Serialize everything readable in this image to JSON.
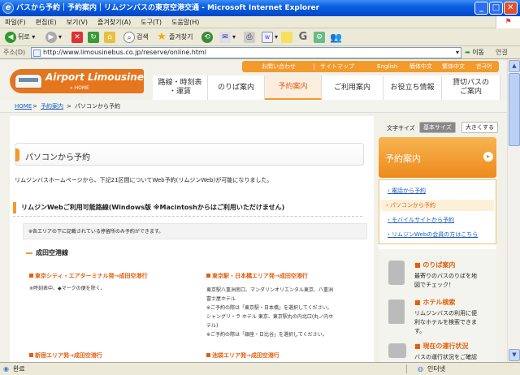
{
  "window": {
    "title": "バスから予約｜予約案内｜リムジンバスの東京空港交通 - Microsoft Internet Explorer"
  },
  "menu": [
    "파일(F)",
    "편집(E)",
    "보기(V)",
    "즐겨찾기(A)",
    "도구(T)",
    "도움말(H)"
  ],
  "toolbar": {
    "back": "뒤로",
    "search": "검색",
    "favorites": "즐겨찾기"
  },
  "address": {
    "label": "주소(D)",
    "url": "http://www.limousinebus.co.jp/reserve/online.html",
    "go": "이동",
    "links": "연결"
  },
  "status": {
    "left": "완료",
    "zone": "인터넷"
  },
  "site": {
    "topnav": [
      "お問い合わせ",
      "サイトマップ",
      "English",
      "簡体中文",
      "繁体中文",
      "한국어"
    ],
    "logo": {
      "name": "Airport Limousine",
      "home": "» HOME"
    },
    "nav": [
      "路線・時刻表\n・運賃",
      "のりば案内",
      "予約案内",
      "ご利用案内",
      "お役立ち情報",
      "貸切バスの\nご案内"
    ],
    "breadcrumb": {
      "home": "HOME",
      "sep": ">",
      "reserve": "予約案内",
      "current": "パソコンから予約"
    },
    "fontsize": {
      "label": "文字サイズ",
      "normal": "基本サイズ",
      "large": "大きくする"
    },
    "heading": "パソコンから予約",
    "intro": "リムジンバスホームページから、下記21区間についてWeb予約(リムジンWeb)が可能になりました。",
    "routes_title": "リムジンWebご利用可能路線(Windows版 ※Macintoshからはご利用いただけません)",
    "note": "※各エリアの下に記載されている停留所のみ予約ができます。",
    "narita": "成田空港線",
    "route1": {
      "title": "東京シティ・エアターミナル発→成田空港行",
      "desc": "※時刻表中、◆マークの便を除く。"
    },
    "route2": {
      "title": "東京駅・日本橋エリア発→成田空港行",
      "lines": [
        "東京駅八重洲南口、マンダリンオリエンタル東京、八重洲",
        "富士屋ホテル",
        "※ご予約の際は「東京駅・日本橋」を選択してください。",
        "シャングリ・ラ ホテル 東京、東京駅丸の内北口(丸ノ内ホ",
        "テル)",
        "※ご予約の際は「銀座・日比谷」を選択してください。"
      ]
    },
    "route3": {
      "title": "新宿エリア発→成田空港行"
    },
    "route4": {
      "title": "池袋エリア発→成田空港行"
    },
    "side": {
      "header": "予約案内",
      "links": [
        "電話から予約",
        "パソコンから予約",
        "モバイルサイトから予約",
        "リムジンWebの会員の方はこちら"
      ],
      "b1": {
        "title": "のりば案内",
        "text": [
          "最寄りのバスのりばを地",
          "図でチェック！"
        ]
      },
      "b2": {
        "title": "ホテル検索",
        "text": [
          "リムジンバスの利用に便",
          "利なホテルを検索できま",
          "す。"
        ]
      },
      "b3": {
        "title": "現在の運行状況",
        "text": [
          "バスの運行状況をご確認"
        ]
      }
    }
  }
}
